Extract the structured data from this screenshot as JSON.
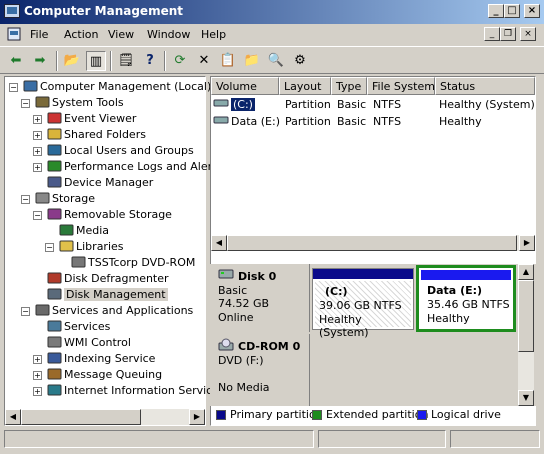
{
  "window": {
    "title": "Computer Management"
  },
  "menu": [
    "File",
    "Action",
    "View",
    "Window",
    "Help"
  ],
  "toolbar": {
    "buttons": [
      "back-icon",
      "forward-icon",
      "up-folder-icon",
      "show-hide-tree-icon",
      "properties-icon",
      "help-icon",
      "refresh-icon",
      "delete-icon",
      "properties-sheet-icon",
      "open-icon",
      "find-icon",
      "settings-icon"
    ]
  },
  "tree": [
    {
      "label": "Computer Management (Local)",
      "level": 0,
      "expander": "−",
      "icon": "computer-icon"
    },
    {
      "label": "System Tools",
      "level": 1,
      "expander": "−",
      "icon": "tools-icon"
    },
    {
      "label": "Event Viewer",
      "level": 2,
      "expander": "+",
      "icon": "event-viewer-icon"
    },
    {
      "label": "Shared Folders",
      "level": 2,
      "expander": "+",
      "icon": "shared-folder-icon"
    },
    {
      "label": "Local Users and Groups",
      "level": 2,
      "expander": "+",
      "icon": "users-icon"
    },
    {
      "label": "Performance Logs and Alerts",
      "level": 2,
      "expander": "+",
      "icon": "performance-icon"
    },
    {
      "label": "Device Manager",
      "level": 2,
      "expander": "",
      "icon": "device-manager-icon"
    },
    {
      "label": "Storage",
      "level": 1,
      "expander": "−",
      "icon": "storage-icon"
    },
    {
      "label": "Removable Storage",
      "level": 2,
      "expander": "−",
      "icon": "removable-storage-icon"
    },
    {
      "label": "Media",
      "level": 3,
      "expander": "",
      "icon": "media-icon"
    },
    {
      "label": "Libraries",
      "level": 3,
      "expander": "−",
      "icon": "folder-icon"
    },
    {
      "label": "TSSTcorp DVD-ROM",
      "level": 4,
      "expander": "",
      "icon": "dvd-drive-icon"
    },
    {
      "label": "Disk Defragmenter",
      "level": 2,
      "expander": "",
      "icon": "defrag-icon"
    },
    {
      "label": "Disk Management",
      "level": 2,
      "expander": "",
      "icon": "disk-management-icon",
      "selected": true
    },
    {
      "label": "Services and Applications",
      "level": 1,
      "expander": "−",
      "icon": "services-apps-icon"
    },
    {
      "label": "Services",
      "level": 2,
      "expander": "",
      "icon": "services-icon"
    },
    {
      "label": "WMI Control",
      "level": 2,
      "expander": "",
      "icon": "wmi-icon"
    },
    {
      "label": "Indexing Service",
      "level": 2,
      "expander": "+",
      "icon": "indexing-icon"
    },
    {
      "label": "Message Queuing",
      "level": 2,
      "expander": "+",
      "icon": "message-queue-icon"
    },
    {
      "label": "Internet Information Services",
      "level": 2,
      "expander": "+",
      "icon": "iis-icon"
    }
  ],
  "volumes": {
    "columns": [
      "Volume",
      "Layout",
      "Type",
      "File System",
      "Status"
    ],
    "rows": [
      {
        "volume": "(C:)",
        "layout": "Partition",
        "type": "Basic",
        "fs": "NTFS",
        "status": "Healthy (System)",
        "selected": true
      },
      {
        "volume": "Data (E:)",
        "layout": "Partition",
        "type": "Basic",
        "fs": "NTFS",
        "status": "Healthy",
        "selected": false
      }
    ]
  },
  "disks": [
    {
      "name": "Disk 0",
      "type": "Basic",
      "size": "74.52 GB",
      "state": "Online",
      "partitions": [
        {
          "name": "(C:)",
          "size": "39.06 GB NTFS",
          "status": "Healthy (System)",
          "color": "#0a0a8a"
        },
        {
          "name": "Data  (E:)",
          "size": "35.46 GB NTFS",
          "status": "Healthy",
          "color": "#1a1aef",
          "selected": true
        }
      ]
    },
    {
      "name": "CD-ROM 0",
      "type": "DVD (F:)",
      "size": "",
      "state": "No Media"
    }
  ],
  "legend": [
    {
      "label": "Primary partition",
      "color": "#0a0a8a"
    },
    {
      "label": "Extended partition",
      "color": "#1e8c1e"
    },
    {
      "label": "Logical drive",
      "color": "#1a1aef"
    }
  ]
}
